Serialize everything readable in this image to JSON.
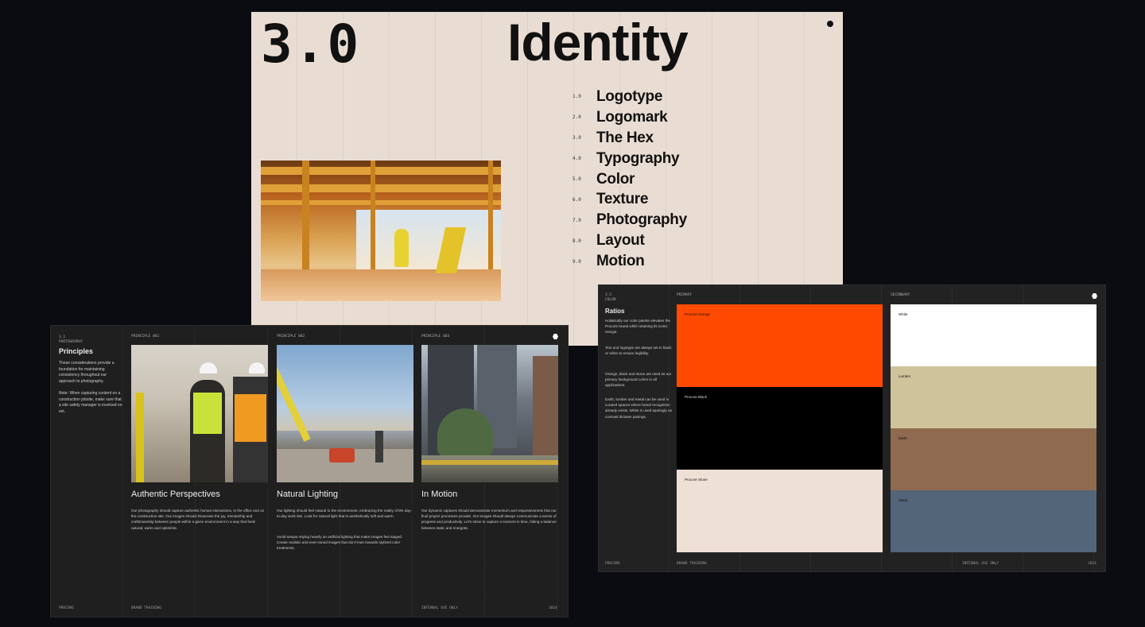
{
  "identity": {
    "number": "3.0",
    "title": "Identity",
    "toc": [
      {
        "num": "1.0",
        "label": "Logotype"
      },
      {
        "num": "2.0",
        "label": "Logomark"
      },
      {
        "num": "3.0",
        "label": "The Hex"
      },
      {
        "num": "4.0",
        "label": "Typography"
      },
      {
        "num": "5.0",
        "label": "Color"
      },
      {
        "num": "6.0",
        "label": "Texture"
      },
      {
        "num": "7.0",
        "label": "Photography"
      },
      {
        "num": "8.0",
        "label": "Layout"
      },
      {
        "num": "9.0",
        "label": "Motion"
      }
    ]
  },
  "photography": {
    "section_num": "3.1",
    "section_name": "PHOTOGRAPHY",
    "heading": "Principles",
    "intro": "These considerations provide a foundation for maintaining consistency throughout our approach to photography.",
    "note": "Note: When capturing content on a construction jobsite, make sure that a site safety manager is involved on set.",
    "principles": [
      {
        "label": "PRINCIPLE 001",
        "title": "Authentic Perspectives",
        "body": "Our photography should capture authentic human interactions, in the office and on the construction site. Our images should showcase the joy, mentorship and craftsmanship between people within a given environment in a way that feels natural, warm and optimistic.",
        "body2": ""
      },
      {
        "label": "PRINCIPLE 002",
        "title": "Natural Lighting",
        "body": "Our lighting should feel natural to the environment, embracing the reality of the day-to-day work site. Look for natural light that is aesthetically soft and warm.",
        "body2": "Avoid setups relying heavily on artificial lighting that make images feel staged. Create realistic and even-toned images that don't lean towards stylized color treatments."
      },
      {
        "label": "PRINCIPLE 003",
        "title": "In Motion",
        "body": "Our dynamic captures should demonstrate momentum and responsiveness that our fluid project processes provide. Our images should always communicate a sense of progress and productivity. Let's strive to capture a moment in time, hitting a balance between static and energetic.",
        "body2": ""
      }
    ],
    "footer": {
      "brand": "PROCORE",
      "training": "BRAND TRAINING",
      "internal": "INTERNAL USE ONLY",
      "year": "2024"
    }
  },
  "color": {
    "section_num": "3.5",
    "section_name": "COLOR",
    "heading": "Ratios",
    "paragraphs": [
      "Holistically our color palette elevates the Procore brand while retaining its iconic orange.",
      "Text and logotype are always set in black or white to ensure legibility.",
      "Orange, black and stone are used as our primary background colors in all applications.",
      "Earth, lumber and metal can be used in curated spaces where brand recognition already exists. White is used sparingly as contrast dictates pairings."
    ],
    "primary_label": "PRIMARY",
    "secondary_label": "SECONDARY",
    "primary": [
      {
        "name": "Procore Orange",
        "hex": "#ff4a00",
        "text": "#111111"
      },
      {
        "name": "Procore Black",
        "hex": "#000000",
        "text": "#dddddd"
      },
      {
        "name": "Procore Stone",
        "hex": "#efe0d6",
        "text": "#111111"
      }
    ],
    "secondary": [
      {
        "name": "White",
        "hex": "#ffffff",
        "text": "#111111"
      },
      {
        "name": "Lumber",
        "hex": "#cfc39c",
        "text": "#111111"
      },
      {
        "name": "Earth",
        "hex": "#8f6a50",
        "text": "#111111"
      },
      {
        "name": "Metal",
        "hex": "#536579",
        "text": "#111111"
      }
    ],
    "footer": {
      "brand": "PROCORE",
      "training": "BRAND TRAINING",
      "internal": "INTERNAL USE ONLY",
      "year": "2024"
    }
  }
}
